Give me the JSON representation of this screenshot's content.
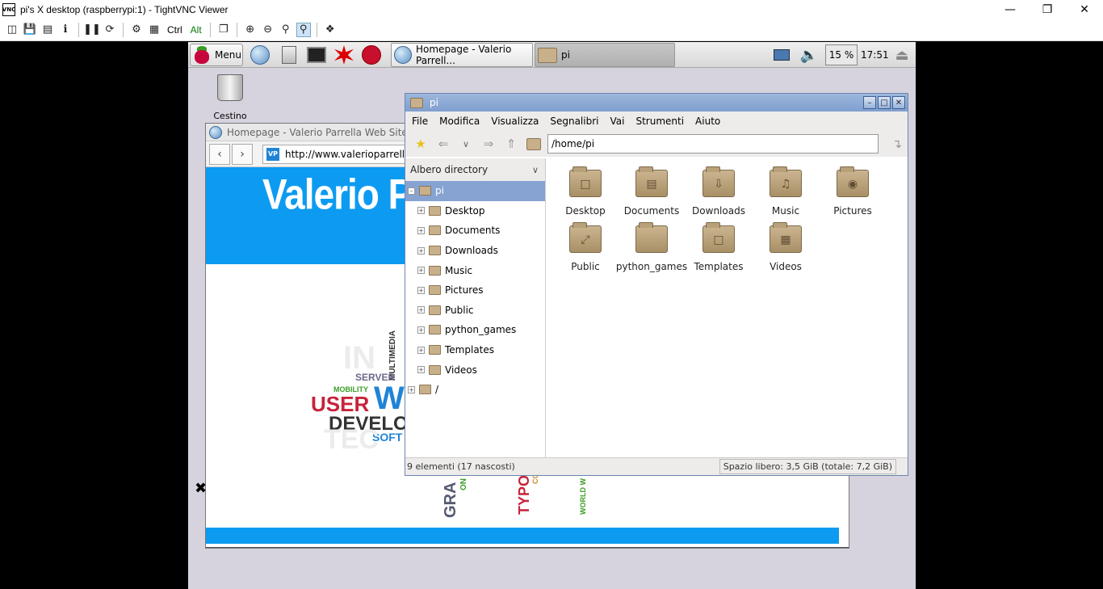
{
  "vnc": {
    "logo": "VNC",
    "title": "pi's X desktop (raspberrypi:1) - TightVNC Viewer",
    "ctrl_text": "Ctrl",
    "alt_text": "Alt"
  },
  "panel": {
    "menu_label": "Menu",
    "task_browser": "Homepage - Valerio Parrell...",
    "task_files": "pi",
    "cpu": "15 %",
    "clock": "17:51"
  },
  "desktop": {
    "trash_label": "Cestino"
  },
  "browser": {
    "title": "Homepage - Valerio Parrella Web Site - Web",
    "url": "http://www.valerioparrella.it/",
    "favicon": "VP",
    "hero_title": "Valerio P",
    "cloud": {
      "w1": "IN",
      "w2": "MULTIMEDIA",
      "w3": "SERVER",
      "w4": "MOBILITY",
      "w5": "USER",
      "w6": "W",
      "w7": "DEVELO",
      "w8": "SOFT",
      "w9": "TEC",
      "w10": "GRA",
      "w11": "ON",
      "w12": "TYPO",
      "w13": "CO",
      "w14": "WORLD W"
    }
  },
  "filemanager": {
    "title": "pi",
    "menu": [
      "File",
      "Modifica",
      "Visualizza",
      "Segnalibri",
      "Vai",
      "Strumenti",
      "Aiuto"
    ],
    "path": "/home/pi",
    "side_header": "Albero directory",
    "tree": [
      "pi",
      "Desktop",
      "Documents",
      "Downloads",
      "Music",
      "Pictures",
      "Public",
      "python_games",
      "Templates",
      "Videos",
      "/"
    ],
    "items": [
      "Desktop",
      "Documents",
      "Downloads",
      "Music",
      "Pictures",
      "Public",
      "python_games",
      "Templates",
      "Videos"
    ],
    "status_left": "9 elementi (17 nascosti)",
    "status_right": "Spazio libero: 3,5 GiB (totale: 7,2 GiB)"
  }
}
